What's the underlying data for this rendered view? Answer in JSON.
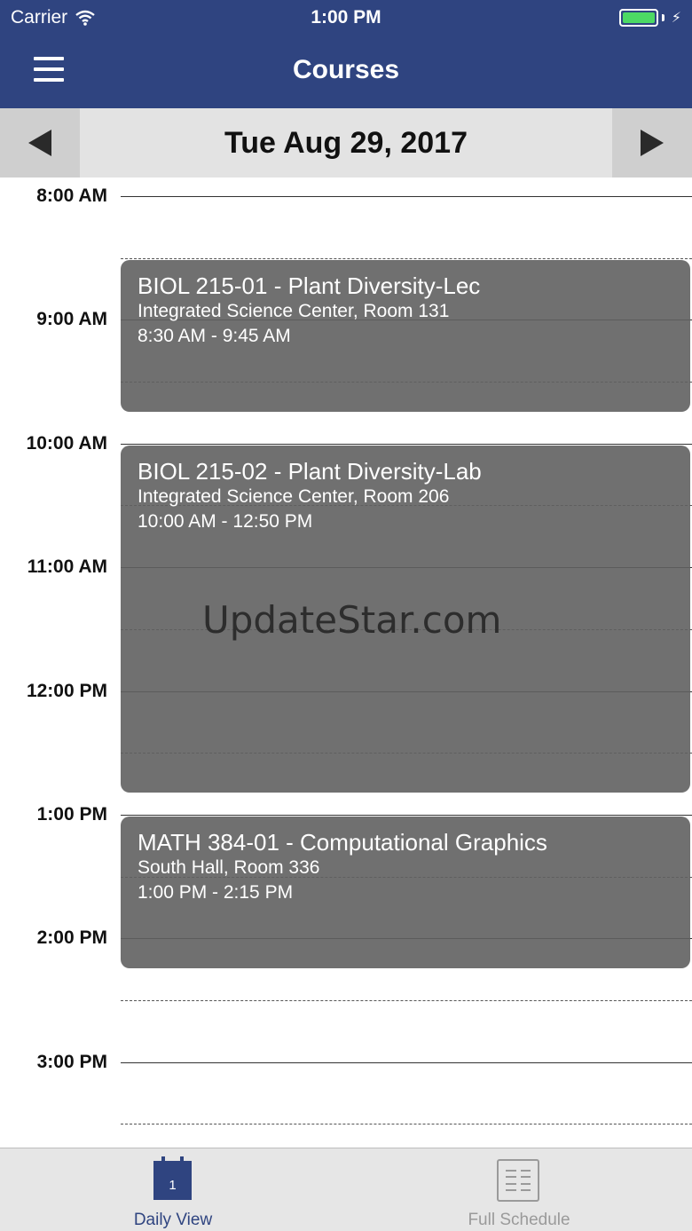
{
  "status_bar": {
    "carrier": "Carrier",
    "time": "1:00 PM"
  },
  "nav": {
    "title": "Courses",
    "menu_icon": "hamburger-menu-icon"
  },
  "date_bar": {
    "date": "Tue Aug 29, 2017",
    "prev_icon": "triangle-left-icon",
    "next_icon": "triangle-right-icon"
  },
  "timeline": {
    "hours": [
      "8:00 AM",
      "9:00 AM",
      "10:00 AM",
      "11:00 AM",
      "12:00 PM",
      "1:00 PM",
      "2:00 PM",
      "3:00 PM"
    ]
  },
  "events": [
    {
      "title": "BIOL 215-01 - Plant Diversity-Lec",
      "location": "Integrated Science Center, Room 131",
      "time": "8:30 AM - 9:45 AM"
    },
    {
      "title": "BIOL 215-02 - Plant Diversity-Lab",
      "location": "Integrated Science Center, Room 206",
      "time": "10:00 AM - 12:50 PM"
    },
    {
      "title": "MATH 384-01 - Computational Graphics",
      "location": "South Hall, Room 336",
      "time": "1:00 PM - 2:15 PM"
    }
  ],
  "watermark": "UpdateStar.com",
  "tabbar": {
    "daily": {
      "label": "Daily View",
      "icon": "calendar-icon",
      "icon_text": "1",
      "active": true
    },
    "full": {
      "label": "Full Schedule",
      "icon": "schedule-list-icon",
      "active": false
    }
  },
  "colors": {
    "primary": "#2f4480",
    "event_bg": "#606060",
    "battery": "#4cd964"
  }
}
